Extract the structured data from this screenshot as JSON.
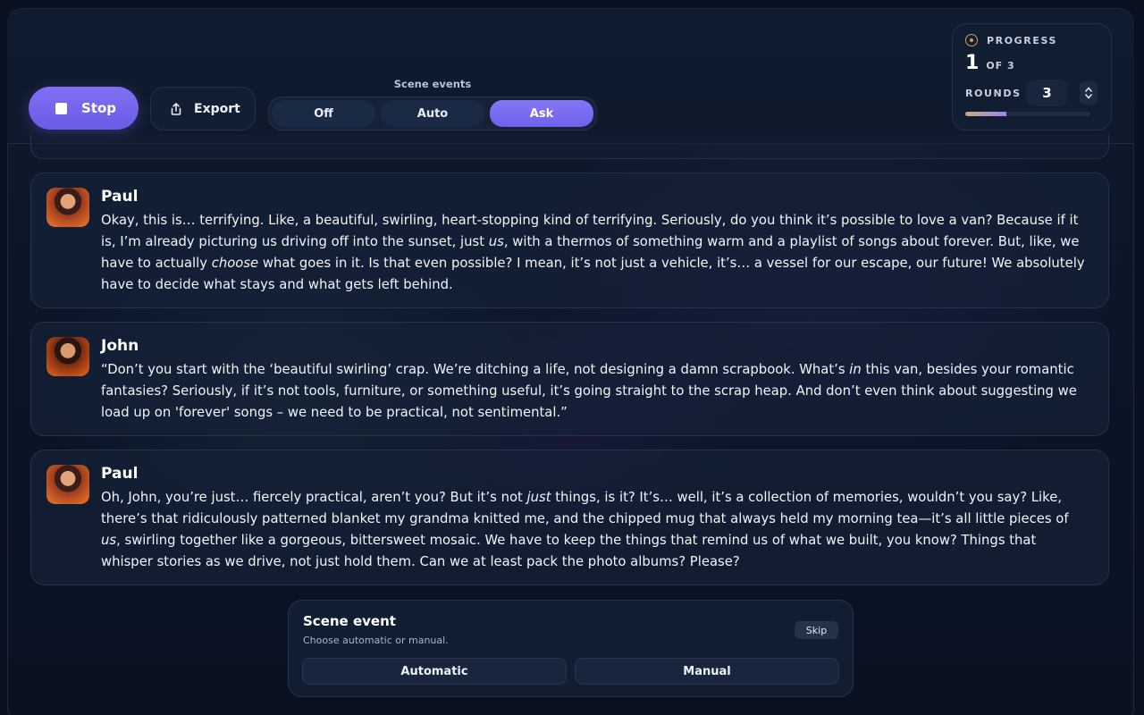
{
  "toolbar": {
    "stop_label": "Stop",
    "export_label": "Export",
    "scene_events_label": "Scene events",
    "scene_modes": [
      {
        "label": "Off",
        "active": false
      },
      {
        "label": "Auto",
        "active": false
      },
      {
        "label": "Ask",
        "active": true
      }
    ]
  },
  "progress": {
    "heading": "PROGRESS",
    "current": "1",
    "of_label": "OF 3",
    "rounds_label": "ROUNDS",
    "rounds_value": "3",
    "fraction_complete": 0.33
  },
  "messages": [
    {
      "name": "Paul",
      "text_parts": [
        "Okay, this is… terrifying. Like, a beautiful, swirling, heart-stopping kind of terrifying. Seriously, do you think it’s possible to love a van? Because if it is, I’m already picturing us driving off into the sunset, just ",
        "us",
        ", with a thermos of something warm and a playlist of songs about forever. But, like, we have to actually ",
        "choose",
        " what goes in it. Is that even possible? I mean, it’s not just a vehicle, it’s… a vessel for our escape, our future! We absolutely have to decide what stays and what gets left behind."
      ]
    },
    {
      "name": "John",
      "text_parts": [
        "“Don’t you start with the ‘beautiful swirling’ crap. We’re ditching a life, not designing a damn scrapbook. What’s ",
        "in",
        " this van, besides your romantic fantasies? Seriously, if it’s not tools, furniture, or something useful, it’s going straight to the scrap heap. And don’t even think about suggesting we load up on 'forever' songs – we need to be practical, not sentimental.”"
      ]
    },
    {
      "name": "Paul",
      "text_parts": [
        "Oh, John, you’re just… fiercely practical, aren’t you? But it’s not ",
        "just",
        " things, is it? It’s… well, it’s a collection of memories, wouldn’t you say? Like, there’s that ridiculously patterned blanket my grandma knitted me, and the chipped mug that always held my morning tea—it’s all little pieces of ",
        "us",
        ", swirling together like a gorgeous, bittersweet mosaic. We have to keep the things that remind us of what we built, you know? Things that whisper stories as we drive, not just hold them. Can we at least pack the photo albums? Please?"
      ]
    }
  ],
  "scene_event": {
    "title": "Scene event",
    "subtitle": "Choose automatic or manual.",
    "skip_label": "Skip",
    "automatic_label": "Automatic",
    "manual_label": "Manual"
  },
  "colors": {
    "accent": "#7a6bf0",
    "background": "#0b1425",
    "card": "#152137"
  },
  "icons": {
    "stop": "stop-square-icon",
    "export": "share-upload-icon",
    "progress": "trophy-icon",
    "stepper": "chevron-up-down-icon"
  }
}
